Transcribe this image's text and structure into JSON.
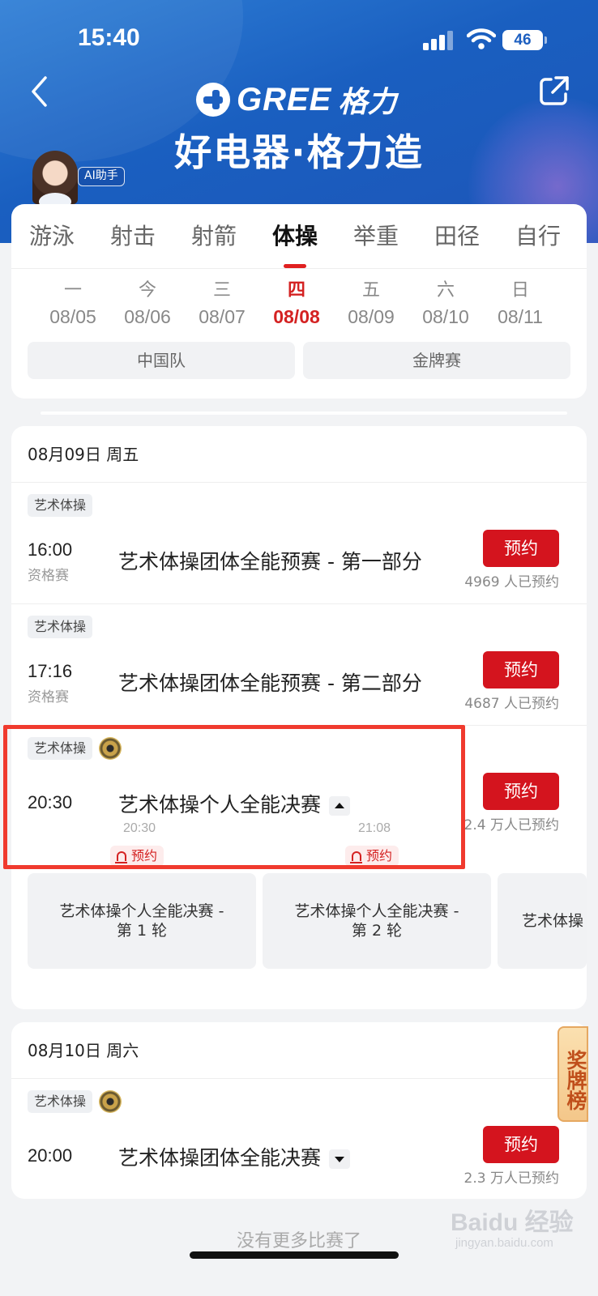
{
  "status_bar": {
    "time": "15:40",
    "battery": "46"
  },
  "header": {
    "brand": "GREE",
    "brand_cn": "格力",
    "slogan": "好电器·格力造",
    "ai_badge": "AI助手"
  },
  "sport_tabs": [
    {
      "label": "游泳"
    },
    {
      "label": "射击"
    },
    {
      "label": "射箭"
    },
    {
      "label": "体操",
      "active": true
    },
    {
      "label": "举重"
    },
    {
      "label": "田径"
    },
    {
      "label": "自行"
    }
  ],
  "days": [
    {
      "weekday": "一",
      "date": "08/05"
    },
    {
      "weekday": "今",
      "date": "08/06"
    },
    {
      "weekday": "三",
      "date": "08/07"
    },
    {
      "weekday": "四",
      "date": "08/08",
      "active": true
    },
    {
      "weekday": "五",
      "date": "08/09"
    },
    {
      "weekday": "六",
      "date": "08/10"
    },
    {
      "weekday": "日",
      "date": "08/11"
    }
  ],
  "filters": {
    "china_team": "中国队",
    "gold_medal": "金牌赛"
  },
  "section1": {
    "date_header": "08月09日 周五",
    "matches": [
      {
        "tag": "艺术体操",
        "time": "16:00",
        "stage": "资格赛",
        "title": "艺术体操团体全能预赛 - 第一部分",
        "reserve": "预约",
        "count": "4969 人已预约"
      },
      {
        "tag": "艺术体操",
        "time": "17:16",
        "stage": "资格赛",
        "title": "艺术体操团体全能预赛 - 第二部分",
        "reserve": "预约",
        "count": "4687 人已预约"
      },
      {
        "tag": "艺术体操",
        "time": "20:30",
        "stage": "",
        "title": "艺术体操个人全能决赛",
        "reserve": "预约",
        "count": "2.4 万人已预约"
      }
    ],
    "sub_events": [
      {
        "time": "20:30",
        "remind": "预约",
        "title_line1": "艺术体操个人全能决赛 -",
        "title_line2": "第 1 轮"
      },
      {
        "time": "21:08",
        "remind": "预约",
        "title_line1": "艺术体操个人全能决赛 -",
        "title_line2": "第 2 轮"
      },
      {
        "title_line1": "艺术体操"
      }
    ]
  },
  "section2": {
    "date_header": "08月10日 周六",
    "matches": [
      {
        "tag": "艺术体操",
        "time": "20:00",
        "stage": "",
        "title": "艺术体操团体全能决赛",
        "reserve": "预约",
        "count": "2.3 万人已预约"
      }
    ]
  },
  "medal_rank_label": "奖牌榜",
  "footer": {
    "no_more": "没有更多比赛了"
  },
  "watermark": {
    "text": "Baidu 经验",
    "sub": "jingyan.baidu.com"
  }
}
